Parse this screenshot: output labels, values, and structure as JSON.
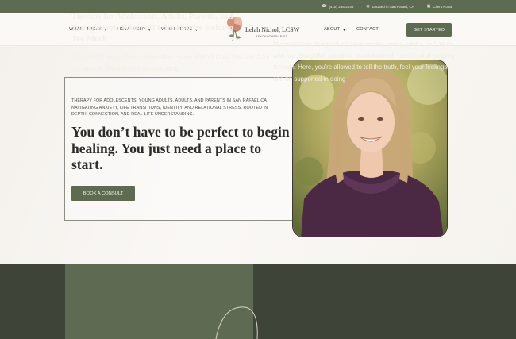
{
  "topbar": {
    "phone": "(415) 238-2146",
    "location": "Located in San Rafael, CA",
    "portal": "Client Portal"
  },
  "nav": {
    "what_i_treat": "WHAT I TREAT",
    "how_i_help": "HOW I HELP",
    "who_i_serve": "WHO I SERVE",
    "about": "ABOUT",
    "contact": "CONTACT",
    "cta": "GET STARTED",
    "logo_name": "Lelah Nichol, LCSW",
    "logo_sub": "PSYCHOTHERAPIST"
  },
  "hero": {
    "subtitle": "THERAPY FOR ADOLESCENTS, YOUNG ADULTS, ADULTS, AND PARENTS IN SAN RAFAEL CA NAVIGATING ANXIETY, LIFE TRANSITIONS, IDENTITY, AND RELATIONAL STRESS. ROOTED IN DEPTH, CONNECTION, AND REAL-LIFE UNDERSTANDING.",
    "heading": "You don’t have to be perfect to begin healing. You just need a place to start.",
    "button": "BOOK A CONSULT"
  },
  "section": {
    "title": "Therapy for Adolescents, Adults, Parents, and Young People Who Feel Like They’re Holding Too Much",
    "left_text": "Life doesn’t always feel manageable—even when it looks that way from the outside. Whether you’re navigating",
    "right_text": "My practice is designed for adolescents, young adults, and adults who are thoughtful, sensitive, overwhelmed—and tired of pushing through. Here, you’re allowed to tell the truth, feel your feelings, and be supported in doing"
  },
  "colors": {
    "brand_green": "#5d6b50",
    "dark_band": "#3f4438",
    "page_bg": "#f7f4ef"
  }
}
